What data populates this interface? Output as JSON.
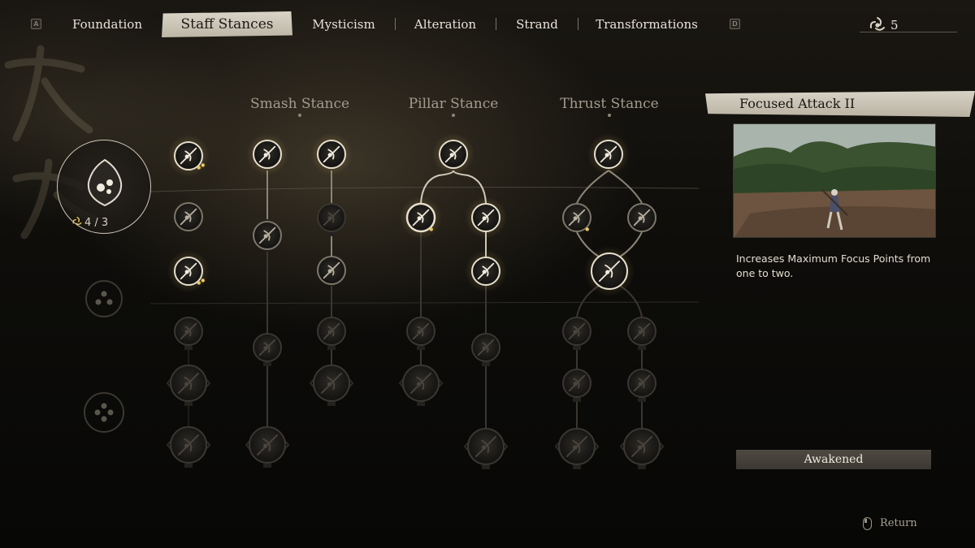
{
  "tabs": {
    "prev_key": "A",
    "next_key": "D",
    "items": [
      {
        "label": "Foundation",
        "active": false
      },
      {
        "label": "Staff Stances",
        "active": true
      },
      {
        "label": "Mysticism",
        "active": false
      },
      {
        "label": "Alteration",
        "active": false
      },
      {
        "label": "Strand",
        "active": false
      },
      {
        "label": "Transformations",
        "active": false
      }
    ]
  },
  "spark_points": {
    "icon": "spark-swirl-icon",
    "value": "5"
  },
  "stance_medallion": {
    "icon": "staff-stance-medallion-icon",
    "progress": "4 / 3"
  },
  "columns": [
    {
      "title": ""
    },
    {
      "title": "Smash Stance"
    },
    {
      "title": "Pillar Stance"
    },
    {
      "title": "Thrust Stance"
    }
  ],
  "detail": {
    "title": "Focused Attack II",
    "description": "Increases Maximum Focus Points from one to two.",
    "status": "Awakened",
    "image": "landscape-with-staff-warrior"
  },
  "return_hint": {
    "icon": "mouse-icon",
    "label": "Return"
  },
  "colors": {
    "accent_gold": "#e8c85a",
    "unlocked_ring": "#e6dfcc",
    "locked_ring": "#3a3731",
    "tab_active_bg": "#d9d4c7"
  },
  "nodes": [
    {
      "id": "foundation-1",
      "icon": "focus-orb-icon",
      "state": "unlocked",
      "pips": 2
    },
    {
      "id": "foundation-2",
      "icon": "staff-spin-icon",
      "state": "available",
      "pips": 0
    },
    {
      "id": "foundation-3",
      "icon": "hook-strike-icon",
      "state": "unlocked",
      "pips": 2
    },
    {
      "id": "foundation-4",
      "icon": "staff-spin-icon",
      "state": "locked",
      "pips": 0
    },
    {
      "id": "foundation-5",
      "icon": "whirl-icon",
      "state": "locked",
      "pips": 0
    },
    {
      "id": "foundation-6",
      "icon": "sweep-icon",
      "state": "locked",
      "pips": 0
    },
    {
      "id": "smash-1",
      "icon": "smash-strike-icon",
      "state": "unlocked",
      "pips": 0
    },
    {
      "id": "smash-2",
      "icon": "shield-slash-icon",
      "state": "available",
      "pips": 0
    },
    {
      "id": "smash-3",
      "icon": "staff-smash-icon",
      "state": "locked",
      "pips": 0
    },
    {
      "id": "smash-4",
      "icon": "heavy-smash-icon",
      "state": "locked",
      "pips": 0
    },
    {
      "id": "smash-5",
      "icon": "cross-staff-icon",
      "state": "unlocked",
      "pips": 0
    },
    {
      "id": "smash-6",
      "icon": "no-slash-icon",
      "state": "locked",
      "pips": 0
    },
    {
      "id": "smash-7",
      "icon": "crescent-icon",
      "state": "available",
      "pips": 0
    },
    {
      "id": "smash-8",
      "icon": "vortex-icon",
      "state": "locked",
      "pips": 0
    },
    {
      "id": "smash-9",
      "icon": "cross-staff-icon",
      "state": "locked",
      "pips": 0
    },
    {
      "id": "pillar-1",
      "icon": "pillar-icon",
      "state": "unlocked",
      "pips": 0
    },
    {
      "id": "pillar-2",
      "icon": "pillar-stand-icon",
      "state": "selected",
      "pips": 1
    },
    {
      "id": "pillar-3",
      "icon": "pillar-stand-icon",
      "state": "unlocked",
      "pips": 0
    },
    {
      "id": "pillar-4",
      "icon": "pillar-spin-icon",
      "state": "unlocked",
      "pips": 0
    },
    {
      "id": "pillar-5",
      "icon": "pillar-stand-icon",
      "state": "locked",
      "pips": 0
    },
    {
      "id": "pillar-6",
      "icon": "pillar-slam-icon",
      "state": "locked",
      "pips": 0
    },
    {
      "id": "pillar-7",
      "icon": "pillar-cross-icon",
      "state": "locked",
      "pips": 0
    },
    {
      "id": "pillar-8",
      "icon": "pinwheel-icon",
      "state": "locked",
      "pips": 0
    },
    {
      "id": "thrust-1",
      "icon": "thrust-line-icon",
      "state": "unlocked",
      "pips": 0
    },
    {
      "id": "thrust-2",
      "icon": "thrust-icon",
      "state": "available",
      "pips": 1
    },
    {
      "id": "thrust-3",
      "icon": "thrust-icon",
      "state": "available",
      "pips": 0
    },
    {
      "id": "thrust-4",
      "icon": "thrust-combo-icon",
      "state": "unlocked",
      "pips": 0
    },
    {
      "id": "thrust-5",
      "icon": "thrust-icon",
      "state": "locked",
      "pips": 0
    },
    {
      "id": "thrust-6",
      "icon": "thrust-icon",
      "state": "locked",
      "pips": 0
    },
    {
      "id": "thrust-7",
      "icon": "feather-thrust-icon",
      "state": "locked",
      "pips": 0
    },
    {
      "id": "thrust-8",
      "icon": "ring-thrust-icon",
      "state": "locked",
      "pips": 0
    },
    {
      "id": "thrust-9",
      "icon": "twin-thrust-icon",
      "state": "locked",
      "pips": 0
    },
    {
      "id": "thrust-10",
      "icon": "star-thrust-icon",
      "state": "locked",
      "pips": 0
    }
  ],
  "unlock_slots": [
    {
      "id": "stance-slot-2",
      "icon": "triple-orb-slot-icon",
      "state": "locked"
    },
    {
      "id": "stance-slot-3",
      "icon": "quad-orb-slot-icon",
      "state": "locked"
    }
  ]
}
